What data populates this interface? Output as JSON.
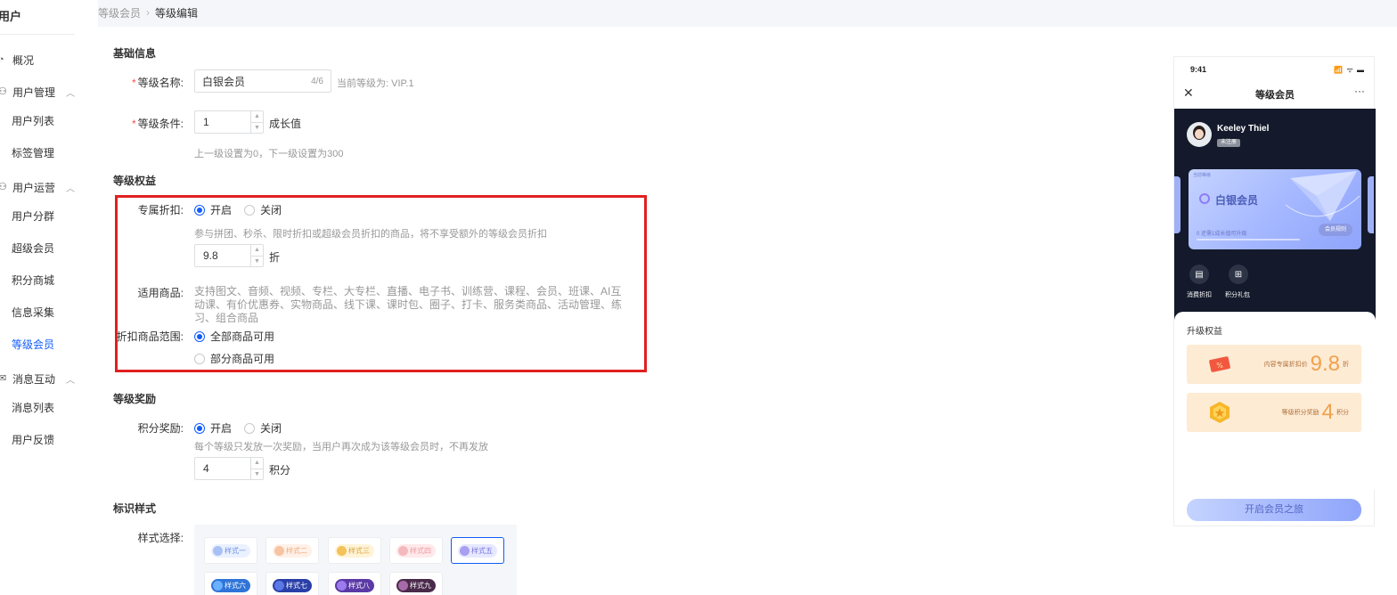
{
  "sidebar": {
    "header": "用户",
    "overview": "概况",
    "groups": [
      {
        "label": "用户管理",
        "items": [
          "用户列表",
          "标签管理"
        ]
      },
      {
        "label": "用户运营",
        "items": [
          "用户分群",
          "超级会员",
          "积分商城",
          "信息采集",
          "等级会员"
        ]
      },
      {
        "label": "消息互动",
        "items": [
          "消息列表",
          "用户反馈"
        ]
      }
    ],
    "active": "等级会员"
  },
  "breadcrumb": {
    "parent": "等级会员",
    "separator": "›",
    "current": "等级编辑"
  },
  "basic": {
    "title": "基础信息",
    "name_label": "等级名称:",
    "name_value": "白银会员",
    "name_count": "4/6",
    "name_hint": "当前等级为: VIP.1",
    "cond_label": "等级条件:",
    "cond_value": "1",
    "cond_unit": "成长值",
    "cond_hint": "上一级设置为0，下一级设置为300"
  },
  "rights": {
    "title": "等级权益",
    "discount_label": "专属折扣:",
    "on": "开启",
    "off": "关闭",
    "discount_hint": "参与拼团、秒杀、限时折扣或超级会员折扣的商品，将不享受额外的等级会员折扣",
    "discount_value": "9.8",
    "discount_unit": "折",
    "goods_label": "适用商品:",
    "goods_text": "支持图文、音频、视频、专栏、大专栏、直播、电子书、训练营、课程、会员、班课、AI互动课、有价优惠券、实物商品、线下课、课时包、圈子、打卡、服务类商品、活动管理、练习、组合商品",
    "scope_label": "折扣商品范围:",
    "scope_all": "全部商品可用",
    "scope_part": "部分商品可用"
  },
  "reward": {
    "title": "等级奖励",
    "points_label": "积分奖励:",
    "on": "开启",
    "off": "关闭",
    "points_hint": "每个等级只发放一次奖励，当用户再次成为该等级会员时，不再发放",
    "points_value": "4",
    "points_unit": "积分"
  },
  "style": {
    "title": "标识样式",
    "label": "样式选择:",
    "options": [
      {
        "label": "样式一",
        "bg": "#eaf1ff",
        "fg": "#6d8de0",
        "ic": "#a9c0f5"
      },
      {
        "label": "样式二",
        "bg": "#fff1e8",
        "fg": "#f0a97a",
        "ic": "#f6c4a1"
      },
      {
        "label": "样式三",
        "bg": "#fff4d8",
        "fg": "#d9a23b",
        "ic": "#f3c258"
      },
      {
        "label": "样式四",
        "bg": "#ffe9ea",
        "fg": "#ee9aa0",
        "ic": "#f5b9bd"
      },
      {
        "label": "样式五",
        "bg": "#e6e9ff",
        "fg": "#7a73e0",
        "ic": "#a89ff0"
      },
      {
        "label": "样式六",
        "bg": "#2f74d8",
        "fg": "#ffffff",
        "ic": "#6ab0ff"
      },
      {
        "label": "样式七",
        "bg": "#2b3fa8",
        "fg": "#ffffff",
        "ic": "#5a78e6"
      },
      {
        "label": "样式八",
        "bg": "#5b3aa6",
        "fg": "#ffffff",
        "ic": "#9c7cec"
      },
      {
        "label": "样式九",
        "bg": "#4a2a4a",
        "fg": "#ffffff",
        "ic": "#a86aa8"
      }
    ],
    "selected": "样式五"
  },
  "preview": {
    "time": "9:41",
    "signal": "📶 ᯤ ▬",
    "title": "等级会员",
    "more": "···",
    "user_name": "Keeley Thiel",
    "user_tag": "未注册",
    "card_small": "当前等级",
    "card_level": "白银会员",
    "card_info": "0 还需1成长值可升级",
    "card_button": "会员规则",
    "icon1_label": "消费折扣",
    "icon2_label": "积分礼包",
    "benefits_title": "升级权益",
    "benefit1_text": "内容专属折扣价",
    "benefit1_value": "9.8",
    "benefit1_unit": "折",
    "benefit2_text": "等级积分奖励",
    "benefit2_value": "4",
    "benefit2_unit": "积分",
    "cta": "开启会员之旅"
  },
  "colors": {
    "accent": "#105cfb",
    "highlight_border": "#e02020",
    "required": "#ff4d4f"
  }
}
